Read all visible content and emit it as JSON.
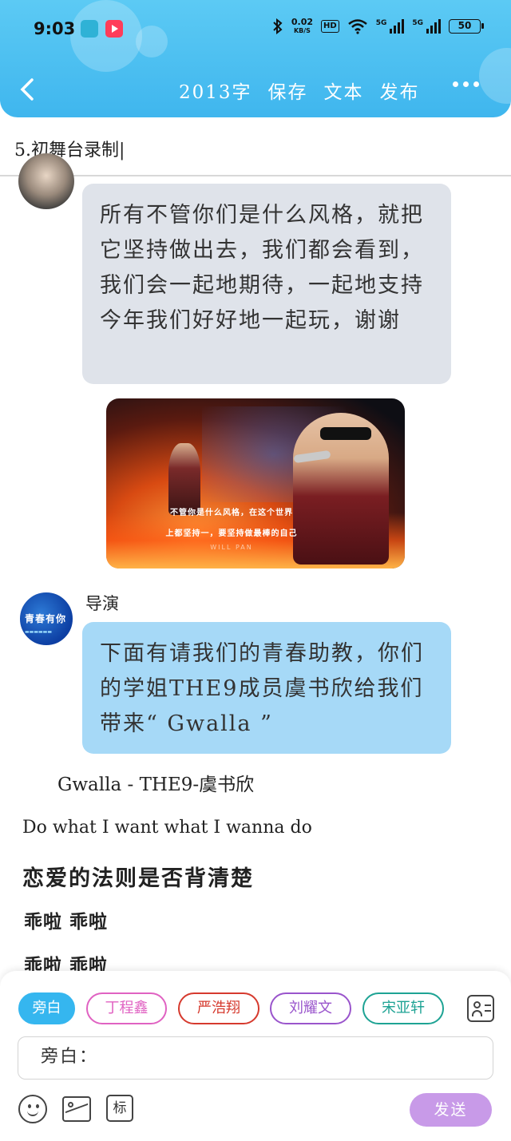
{
  "status_bar": {
    "time": "9:03",
    "net_speed_value": "0.02",
    "net_speed_unit": "KB/S",
    "hd_label": "HD",
    "signal_label_1": "5G",
    "signal_label_2": "5G",
    "battery": "50",
    "icons": [
      "boss-app-icon",
      "video-app-icon",
      "bluetooth-icon",
      "wifi-icon",
      "signal-icon",
      "battery-icon"
    ]
  },
  "header": {
    "word_count": "2013字",
    "save_label": "保存",
    "text_label": "文本",
    "publish_label": "发布",
    "accent_color": "#3fb6ee"
  },
  "chapter": {
    "title": "5.初舞台录制"
  },
  "messages": [
    {
      "type": "text",
      "text": "所有不管你们是什么风格，就把它坚持做出去，我们都会看到，我们会一起地期待，一起地支持今年我们好好地一起玩，谢谢"
    },
    {
      "type": "video",
      "subtitle_1": "不管你是什么风格，在这个世界",
      "subtitle_2": "上都坚持一，要坚持做最棒的自己",
      "credit": "WILL PAN"
    },
    {
      "type": "text",
      "speaker": "导演",
      "avatar_text": "青春有你",
      "text": "下面有请我们的青春助教，你们的学姐THE9成员虞书欣给我们带来“ Gwalla ”"
    }
  ],
  "lyrics": {
    "title": "Gwalla - THE9-虞书欣",
    "line_1": "Do what I want what I wanna do",
    "line_2": "恋爱的法则是否背清楚",
    "line_3": "乖啦 乖啦",
    "line_4": "乖啦 乖啦"
  },
  "composer": {
    "chips": [
      {
        "label": "旁白",
        "color": "#35b6ef"
      },
      {
        "label": "丁程鑫",
        "color": "#e062c2"
      },
      {
        "label": "严浩翔",
        "color": "#d63a2e"
      },
      {
        "label": "刘耀文",
        "color": "#9a55cc"
      },
      {
        "label": "宋亚轩",
        "color": "#1ea394"
      }
    ],
    "input_value": "旁白：",
    "tag_label": "标",
    "send_label": "发送",
    "send_color": "#c89ae8"
  }
}
